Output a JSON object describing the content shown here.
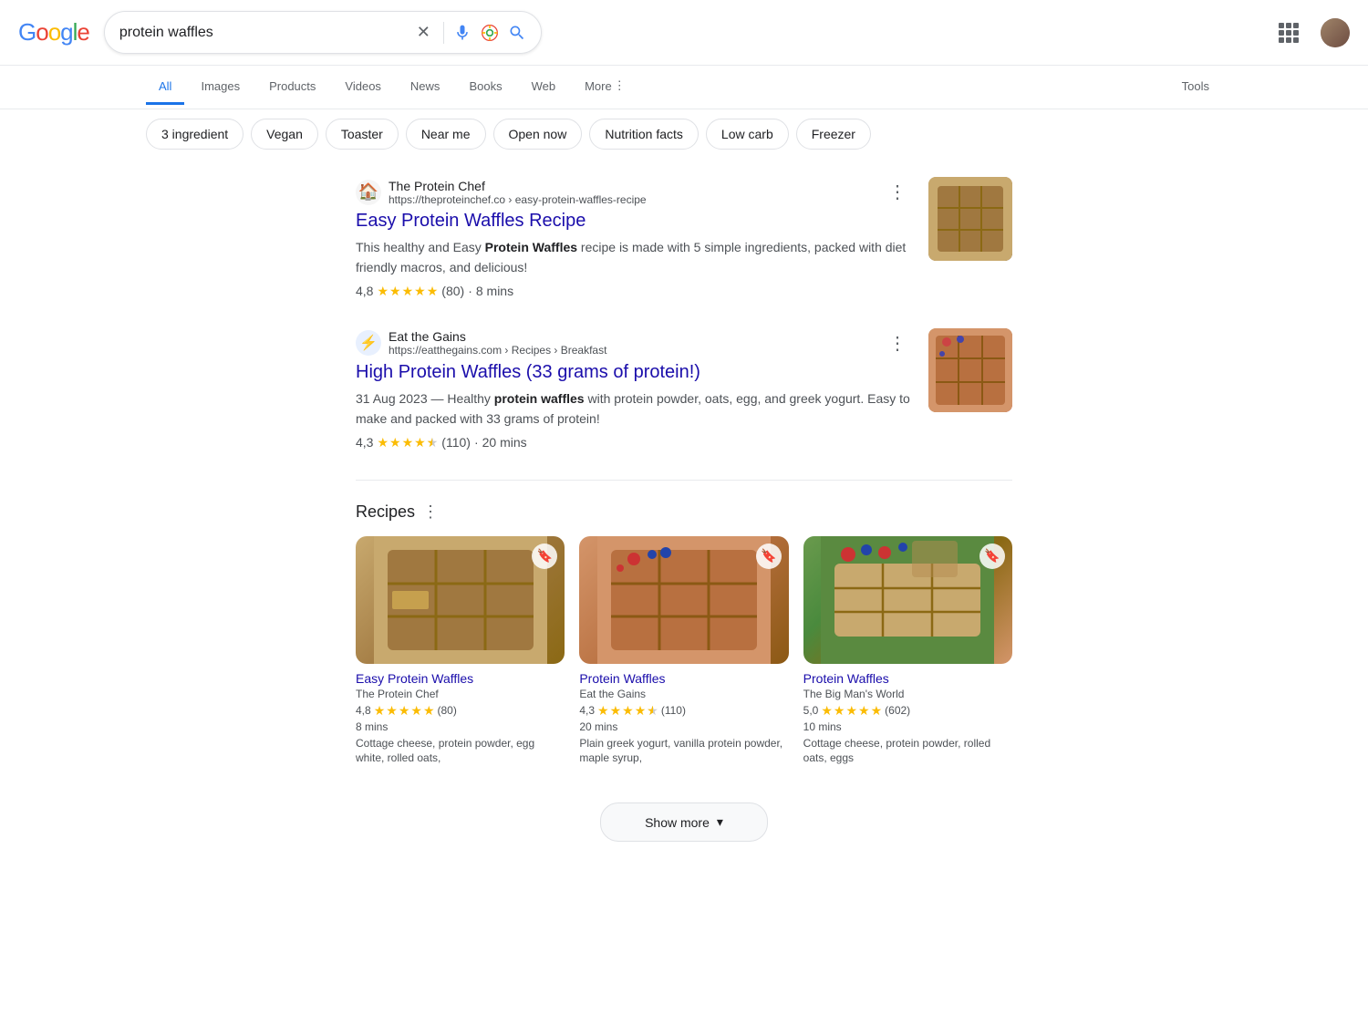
{
  "header": {
    "logo": "Google",
    "search_query": "protein waffles",
    "tools_label": "Tools"
  },
  "nav": {
    "tabs": [
      {
        "id": "all",
        "label": "All",
        "active": true
      },
      {
        "id": "images",
        "label": "Images",
        "active": false
      },
      {
        "id": "products",
        "label": "Products",
        "active": false
      },
      {
        "id": "videos",
        "label": "Videos",
        "active": false
      },
      {
        "id": "news",
        "label": "News",
        "active": false
      },
      {
        "id": "books",
        "label": "Books",
        "active": false
      },
      {
        "id": "web",
        "label": "Web",
        "active": false
      },
      {
        "id": "more",
        "label": "More",
        "active": false
      }
    ],
    "tools": "Tools"
  },
  "filters": {
    "chips": [
      {
        "id": "3ingredient",
        "label": "3 ingredient"
      },
      {
        "id": "vegan",
        "label": "Vegan"
      },
      {
        "id": "toaster",
        "label": "Toaster"
      },
      {
        "id": "near-me",
        "label": "Near me"
      },
      {
        "id": "open-now",
        "label": "Open now"
      },
      {
        "id": "nutrition-facts",
        "label": "Nutrition facts"
      },
      {
        "id": "low-carb",
        "label": "Low carb"
      },
      {
        "id": "freezer",
        "label": "Freezer"
      }
    ]
  },
  "results": [
    {
      "id": "result-1",
      "source_name": "The Protein Chef",
      "source_url": "https://theproteinchef.co › easy-protein-waffles-recipe",
      "title": "Easy Protein Waffles Recipe",
      "description": "This healthy and Easy <b>Protein Waffles</b> recipe is made with 5 simple ingredients, packed with diet friendly macros, and delicious!",
      "rating": "4,8",
      "rating_count": "(80)",
      "time": "8 mins",
      "star_count": 5
    },
    {
      "id": "result-2",
      "source_name": "Eat the Gains",
      "source_url": "https://eatthegains.com › Recipes › Breakfast",
      "title": "High Protein Waffles (33 grams of protein!)",
      "description": "31 Aug 2023 — Healthy <b>protein waffles</b> with protein powder, oats, egg, and greek yogurt. Easy to make and packed with 33 grams of protein!",
      "rating": "4,3",
      "rating_count": "(110)",
      "time": "20 mins",
      "star_count": 4.5
    }
  ],
  "recipes_section": {
    "title": "Recipes",
    "cards": [
      {
        "id": "card-1",
        "name": "Easy Protein Waffles",
        "source": "The Protein Chef",
        "rating": "4,8",
        "rating_count": "(80)",
        "time": "8 mins",
        "ingredients": "Cottage cheese, protein powder, egg white, rolled oats,",
        "star_count": 5
      },
      {
        "id": "card-2",
        "name": "Protein Waffles",
        "source": "Eat the Gains",
        "rating": "4,3",
        "rating_count": "(110)",
        "time": "20 mins",
        "ingredients": "Plain greek yogurt, vanilla protein powder, maple syrup,",
        "star_count": 4.5
      },
      {
        "id": "card-3",
        "name": "Protein Waffles",
        "source": "The Big Man's World",
        "rating": "5,0",
        "rating_count": "(602)",
        "time": "10 mins",
        "ingredients": "Cottage cheese, protein powder, rolled oats, eggs",
        "star_count": 5
      }
    ]
  },
  "show_more": {
    "label": "Show more",
    "chevron": "▾"
  }
}
